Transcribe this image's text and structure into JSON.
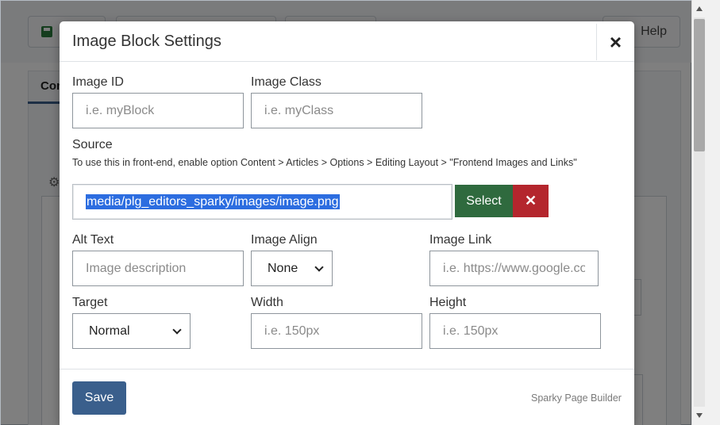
{
  "background": {
    "tab_label": "Con",
    "help_label": "Help",
    "gear_icon": "gear-icon",
    "save_icon": "floppy-disk-icon"
  },
  "modal": {
    "title": "Image Block Settings",
    "close_glyph": "×",
    "image_id": {
      "label": "Image ID",
      "placeholder": "i.e. myBlock"
    },
    "image_class": {
      "label": "Image Class",
      "placeholder": "i.e. myClass"
    },
    "source": {
      "label": "Source",
      "help": "To use this in front-end, enable option Content > Articles > Options > Editing Layout > \"Frontend Images and Links\"",
      "value": "media/plg_editors_sparky/images/image.png",
      "select_label": "Select",
      "clear_glyph": "✕"
    },
    "alt_text": {
      "label": "Alt Text",
      "placeholder": "Image description"
    },
    "image_align": {
      "label": "Image Align",
      "selected": "None"
    },
    "image_link": {
      "label": "Image Link",
      "placeholder": "i.e. https://www.google.com"
    },
    "target": {
      "label": "Target",
      "selected": "Normal"
    },
    "width": {
      "label": "Width",
      "placeholder": "i.e. 150px"
    },
    "height": {
      "label": "Height",
      "placeholder": "i.e. 150px"
    },
    "save_label": "Save",
    "brand": "Sparky Page Builder"
  },
  "colors": {
    "select_button": "#2f6a3e",
    "clear_button": "#b4262d",
    "save_button": "#3a5f8c",
    "selection_highlight": "#2c6de0"
  }
}
